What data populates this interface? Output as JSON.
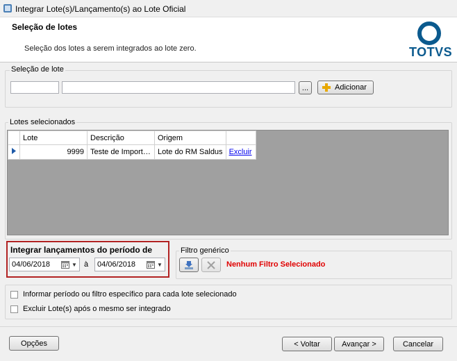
{
  "window": {
    "title": "Integrar Lote(s)/Lançamento(s) ao Lote Oficial"
  },
  "header": {
    "title": "Seleção de lotes",
    "subtitle": "Seleção dos lotes a serem integrados ao lote zero.",
    "logo_text": "TOTVS"
  },
  "selecao_lote": {
    "label": "Seleção de lote",
    "code_value": "",
    "desc_value": "",
    "browse_label": "...",
    "add_label": "Adicionar"
  },
  "lotes_selecionados": {
    "label": "Lotes selecionados",
    "columns": [
      "Lote",
      "Descrição",
      "Origem"
    ],
    "rows": [
      {
        "lote": "9999",
        "descricao": "Teste de Import…",
        "origem": "Lote do RM Saldus",
        "action": "Excluir"
      }
    ]
  },
  "periodo": {
    "label": "Integrar lançamentos do período de",
    "start": "04/06/2018",
    "separator": "à",
    "end": "04/06/2018"
  },
  "filtro": {
    "label": "Filtro genérico",
    "status": "Nenhum Filtro Selecionado"
  },
  "options": {
    "informar_periodo": "Informar período ou filtro específico para cada lote selecionado",
    "excluir_lote": "Excluir Lote(s) após o mesmo ser integrado"
  },
  "footer": {
    "opcoes": "Opções",
    "voltar": "< Voltar",
    "avancar": "Avançar >",
    "cancelar": "Cancelar"
  },
  "colors": {
    "brand": "#0b5a8e",
    "highlight_border": "#b22222",
    "filter_status": "#e00000",
    "link": "#0000ee"
  }
}
